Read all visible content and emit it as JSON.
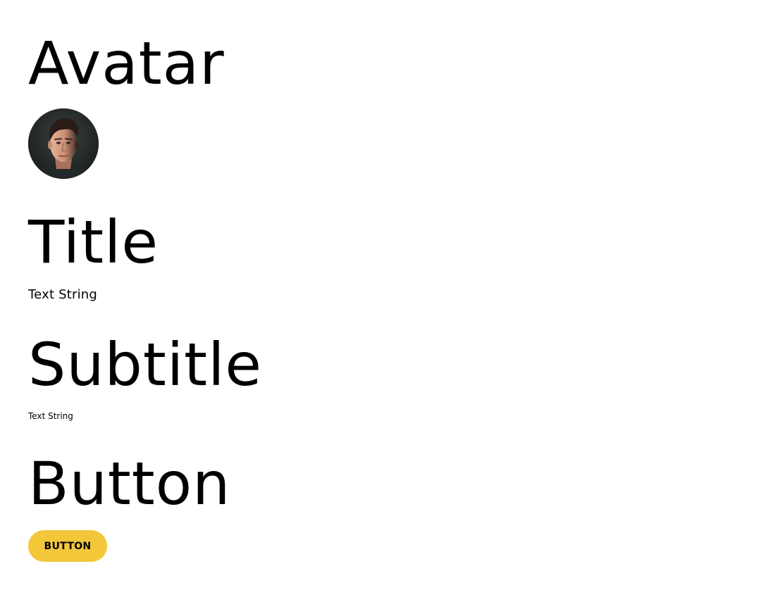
{
  "sections": {
    "avatar": {
      "heading": "Avatar",
      "image_icon": "person-portrait-icon"
    },
    "title": {
      "heading": "Title",
      "text": "Text String"
    },
    "subtitle": {
      "heading": "Subtitle",
      "text": "Text String"
    },
    "button": {
      "heading": "Button",
      "label": "BUTTON"
    }
  },
  "colors": {
    "button_background": "#f3c73a",
    "text": "#000000",
    "page_background": "#ffffff"
  }
}
